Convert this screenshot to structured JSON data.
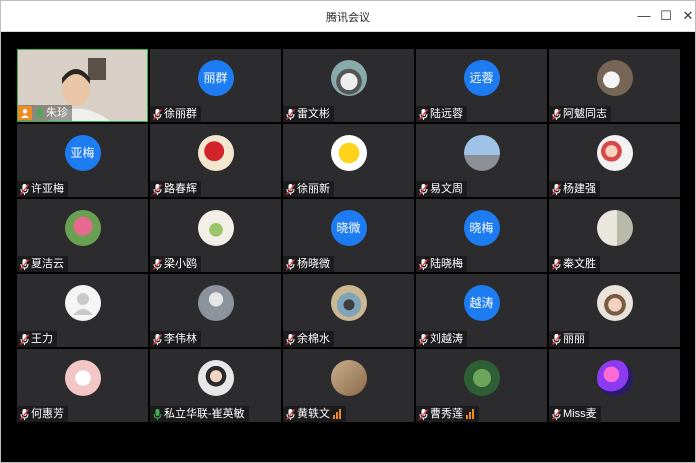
{
  "window": {
    "title": "腾讯会议",
    "controls": {
      "minimize": "—",
      "maximize": "☐",
      "close": "✕"
    }
  },
  "participants": [
    {
      "name": "朱珍",
      "avatar_type": "camera",
      "mic": "on",
      "host": true
    },
    {
      "name": "徐丽群",
      "avatar_type": "text",
      "avatar_text": "丽群",
      "mic": "muted"
    },
    {
      "name": "雷文彬",
      "avatar_type": "photo",
      "photo_hint": "car",
      "mic": "muted"
    },
    {
      "name": "陆远蓉",
      "avatar_type": "text",
      "avatar_text": "远蓉",
      "mic": "muted"
    },
    {
      "name": "阿魃同志",
      "avatar_type": "photo",
      "photo_hint": "cup",
      "mic": "muted"
    },
    {
      "name": "许亚梅",
      "avatar_type": "text",
      "avatar_text": "亚梅",
      "mic": "muted"
    },
    {
      "name": "路春辉",
      "avatar_type": "photo",
      "photo_hint": "red-toy",
      "mic": "muted"
    },
    {
      "name": "徐丽新",
      "avatar_type": "photo",
      "photo_hint": "smiley-star",
      "mic": "muted"
    },
    {
      "name": "易文周",
      "avatar_type": "photo",
      "photo_hint": "sky-city",
      "mic": "muted"
    },
    {
      "name": "杨建强",
      "avatar_type": "photo",
      "photo_hint": "kids",
      "mic": "muted"
    },
    {
      "name": "夏洁云",
      "avatar_type": "photo",
      "photo_hint": "pink-flower",
      "mic": "muted"
    },
    {
      "name": "梁小鸥",
      "avatar_type": "photo",
      "photo_hint": "sprout",
      "mic": "muted"
    },
    {
      "name": "杨晓微",
      "avatar_type": "text",
      "avatar_text": "晓微",
      "mic": "muted"
    },
    {
      "name": "陆晓梅",
      "avatar_type": "text",
      "avatar_text": "晓梅",
      "mic": "muted"
    },
    {
      "name": "秦文胜",
      "avatar_type": "photo",
      "photo_hint": "plant",
      "mic": "muted"
    },
    {
      "name": "王力",
      "avatar_type": "default",
      "mic": "muted"
    },
    {
      "name": "李伟林",
      "avatar_type": "photo",
      "photo_hint": "gray-scene",
      "mic": "muted"
    },
    {
      "name": "余棉水",
      "avatar_type": "photo",
      "photo_hint": "bridge",
      "mic": "muted"
    },
    {
      "name": "刘越涛",
      "avatar_type": "text",
      "avatar_text": "越涛",
      "mic": "muted"
    },
    {
      "name": "丽丽",
      "avatar_type": "photo",
      "photo_hint": "girl",
      "mic": "muted"
    },
    {
      "name": "何惠芳",
      "avatar_type": "photo",
      "photo_hint": "cartoon",
      "mic": "muted"
    },
    {
      "name": "私立华联-崔英敏",
      "avatar_type": "photo",
      "photo_hint": "woman",
      "mic": "on"
    },
    {
      "name": "黄轶文",
      "avatar_type": "photo",
      "photo_hint": "brown-photo",
      "mic": "muted",
      "signal": true
    },
    {
      "name": "曹秀莲",
      "avatar_type": "photo",
      "photo_hint": "lotus",
      "mic": "muted",
      "signal": true
    },
    {
      "name": "Miss麦",
      "avatar_type": "photo",
      "photo_hint": "pink-purple",
      "mic": "muted"
    }
  ],
  "colors": {
    "avatar_blue": "#1e7cf2",
    "tile_bg": "#2c2c2e",
    "mic_muted": "#e23a3a",
    "mic_on": "#3cb34a",
    "active_border": "#3cb34a",
    "signal": "#f08a24"
  }
}
